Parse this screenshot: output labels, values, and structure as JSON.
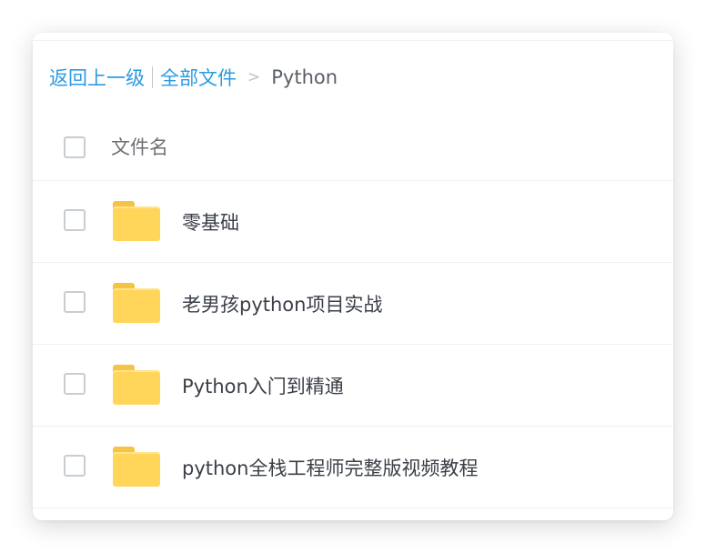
{
  "breadcrumb": {
    "back_label": "返回上一级",
    "root_label": "全部文件",
    "separator": ">",
    "current": "Python"
  },
  "table": {
    "header_label": "文件名"
  },
  "files": [
    {
      "name": "零基础",
      "icon": "folder-icon"
    },
    {
      "name": "老男孩python项目实战",
      "icon": "folder-icon"
    },
    {
      "name": "Python入门到精通",
      "icon": "folder-icon"
    },
    {
      "name": "python全栈工程师完整版视频教程",
      "icon": "folder-icon"
    }
  ],
  "colors": {
    "link": "#2c9ae0",
    "folder": "#ffd55a",
    "text": "#3b4048"
  }
}
